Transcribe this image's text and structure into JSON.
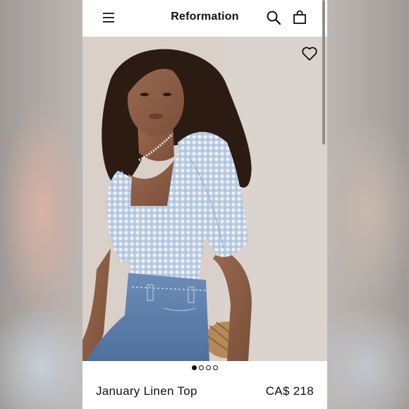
{
  "header": {
    "brand": "Reformation",
    "menu_icon": "hamburger-menu-icon",
    "search_icon": "search-icon",
    "bag_icon": "shopping-bag-icon"
  },
  "gallery": {
    "wishlist_icon": "heart-outline-icon",
    "dots_total": 4,
    "dots_active": 1
  },
  "product": {
    "name": "January Linen Top",
    "price": "CA$ 218"
  },
  "colors": {
    "text": "#111111",
    "background": "#ffffff",
    "gingham": "#a9bfdc",
    "denim": "#5f80ad"
  }
}
